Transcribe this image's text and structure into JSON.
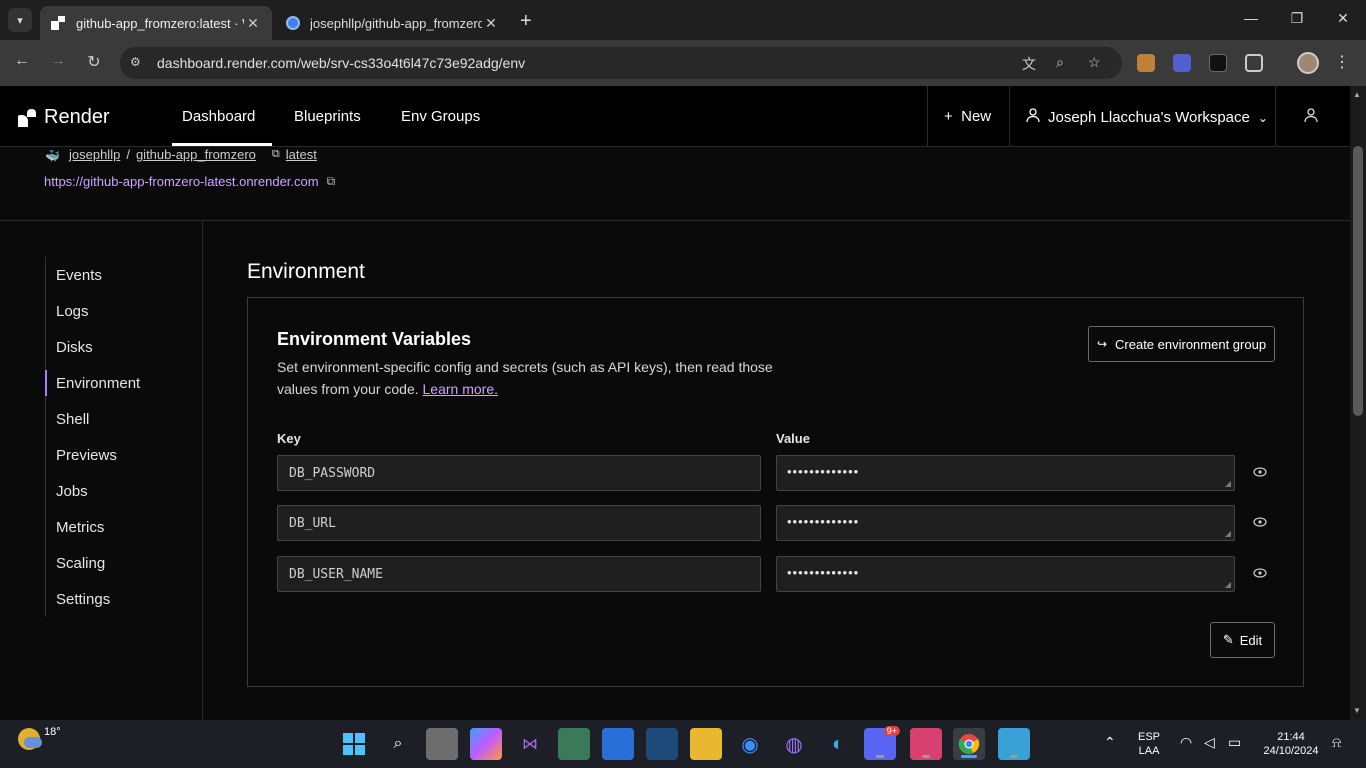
{
  "browser": {
    "tabs": [
      {
        "title": "github-app_fromzero:latest · W",
        "active": true
      },
      {
        "title": "josephllp/github-app_fromzero",
        "active": false
      }
    ],
    "url": "dashboard.render.com/web/srv-cs33o4t6l47c73e92adg/env"
  },
  "header": {
    "logo": "Render",
    "nav": [
      "Dashboard",
      "Blueprints",
      "Env Groups"
    ],
    "active_nav": "Dashboard",
    "new_label": "New",
    "workspace": "Joseph Llacchua's Workspace"
  },
  "service": {
    "repo_owner": "josephllp",
    "repo_name": "github-app_fromzero",
    "tag": "latest",
    "url": "https://github-app-fromzero-latest.onrender.com"
  },
  "sidebar": {
    "items": [
      "Events",
      "Logs",
      "Disks",
      "Environment",
      "Shell",
      "Previews",
      "Jobs",
      "Metrics",
      "Scaling",
      "Settings"
    ],
    "active": "Environment"
  },
  "main": {
    "title": "Environment",
    "card": {
      "title": "Environment Variables",
      "description": "Set environment-specific config and secrets (such as API keys), then read those values from your code.",
      "learn_more": "Learn more.",
      "create_group_label": "Create environment group",
      "key_label": "Key",
      "value_label": "Value",
      "variables": [
        {
          "key": "DB_PASSWORD",
          "value": "•••••••••••••"
        },
        {
          "key": "DB_URL",
          "value": "•••••••••••••"
        },
        {
          "key": "DB_USER_NAME",
          "value": "•••••••••••••"
        }
      ],
      "edit_label": "Edit"
    }
  },
  "taskbar": {
    "weather": "18°",
    "discord_badge": "9+",
    "lang_top": "ESP",
    "lang_bottom": "LAA",
    "time": "21:44",
    "date": "24/10/2024"
  }
}
